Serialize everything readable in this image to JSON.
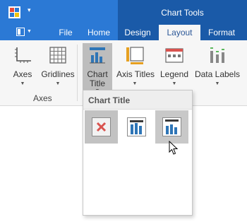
{
  "title_bar": {
    "context_group_label": "Chart Tools"
  },
  "tabs": [
    {
      "label": "File",
      "active": false
    },
    {
      "label": "Home",
      "active": false
    },
    {
      "label": "Design",
      "active": false
    },
    {
      "label": "Layout",
      "active": true
    },
    {
      "label": "Format",
      "active": false
    }
  ],
  "ribbon": {
    "buttons": {
      "axes": "Axes",
      "gridlines": "Gridlines",
      "chart_title_line1": "Chart",
      "chart_title_line2": "Title",
      "axis_titles": "Axis Titles",
      "legend": "Legend",
      "data_labels": "Data Labels"
    },
    "groups": {
      "axes": "Axes"
    }
  },
  "gallery": {
    "header": "Chart Title",
    "items": [
      {
        "icon": "no-chart-title-icon",
        "selected": true
      },
      {
        "icon": "chart-title-overlay-icon",
        "selected": false
      },
      {
        "icon": "chart-title-above-icon",
        "selected": false,
        "hover": true
      }
    ]
  },
  "colors": {
    "titlebar": "#2b79d5",
    "context_tab": "#1a5aa8",
    "ribbon": "#f6f6f6",
    "accent_red": "#d9534f"
  }
}
